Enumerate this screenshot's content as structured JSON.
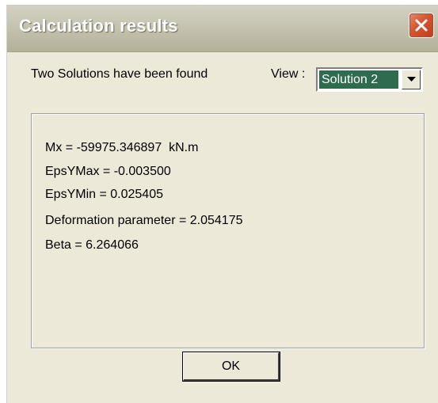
{
  "window": {
    "title": "Calculation results"
  },
  "header": {
    "info_text": "Two Solutions have been found",
    "view_label": "View :",
    "view_selected": "Solution 2"
  },
  "results": [
    "Mx = -59975.346897  kN.m",
    "EpsYMax = -0.003500",
    "EpsYMin = 0.025405",
    "Deformation parameter = 2.054175",
    "Beta = 6.264066"
  ],
  "buttons": {
    "ok_label": "OK"
  },
  "colors": {
    "titlebar": "#c9c7b5",
    "close_button": "#d5542f",
    "selection": "#2e6b4f",
    "dialog_bg": "#ece9d8"
  },
  "icons": {
    "close": "close-icon",
    "dropdown": "chevron-down-icon"
  }
}
